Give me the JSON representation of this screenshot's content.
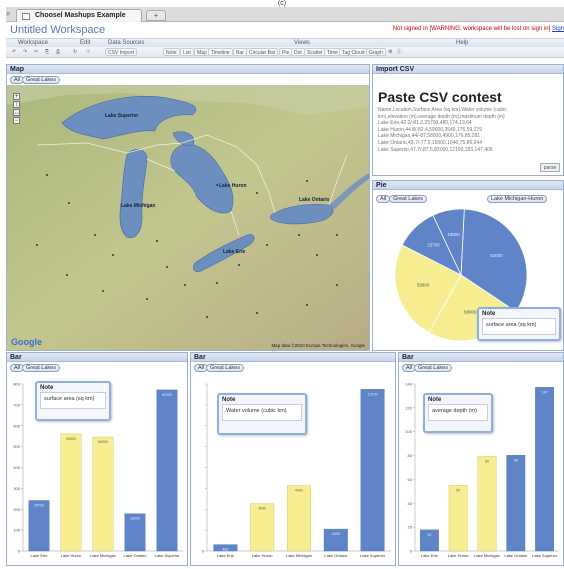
{
  "caption": "(c)",
  "browser": {
    "tab_title": "Choosel Mashups Example",
    "new_tab": "+"
  },
  "app": {
    "workspace_title": "Untitled Workspace",
    "warning": "Not signed in [WARNING: workspace will be lost on sign in]",
    "sign_in": "Sign"
  },
  "menubar": {
    "workspace": "Workspace",
    "edit": "Edit",
    "data_sources": "Data Sources",
    "views": "Views",
    "help": "Help"
  },
  "toolbar": [
    "CSV Import",
    "Note",
    "List",
    "Map",
    "Timeline",
    "Bar",
    "Circular Bar",
    "Pie",
    "Dot",
    "Scatter",
    "Time",
    "Tag Cloud",
    "Graph"
  ],
  "map_panel": {
    "title": "Map",
    "pills": [
      "All",
      "Great Lakes"
    ],
    "labels": [
      "Lake Superior",
      "Lake Michigan",
      "Lake Huron",
      "Lake Ontario",
      "Lake Erie"
    ],
    "google": "Google",
    "copyright": "Map data ©2010 Europa Technologies, Google"
  },
  "csv_panel": {
    "title": "Import CSV",
    "heading": "Paste CSV contest",
    "lines": [
      "Name,Location,Surface Area (sq km),Water volume (cubic",
      "km),elevation (m),average depth (m),maximum depth (m)",
      "Lake Erie,42.2/-81.2,25700,480,174,19,64",
      "Lake Huron,44.8/-82.4,59600,3540,176,59,229",
      "Lake Michigan,44/-87,58000,4900,176,85,281",
      "Lake Ontario,43.7/-77.9,19000,1640,75,86,244",
      "Lake Superior,47.7/-87.5,82000,12100,183,147,406"
    ],
    "parse": "parse"
  },
  "pie_panel": {
    "title": "Pie",
    "pills": [
      "All",
      "Great Lakes"
    ],
    "selected": "Lake Michigan-Huron",
    "note_title": "Note",
    "note_text": "surface area (sq km)"
  },
  "bar_panels": [
    {
      "title": "Bar",
      "pills": [
        "All",
        "Great Lakes"
      ],
      "note_title": "Note",
      "note_text": "surface area (sq km)"
    },
    {
      "title": "Bar",
      "pills": [
        "All",
        "Great Lakes"
      ],
      "note_title": "Note",
      "note_text": "Water volume (cubic km)"
    },
    {
      "title": "Bar",
      "pills": [
        "All",
        "Great Lakes"
      ],
      "note_title": "Note",
      "note_text": "average depth (m)"
    }
  ],
  "colors": {
    "blue": "#5f85c8",
    "yellow": "#f6ee90",
    "selected_blue": "#4877c5"
  },
  "chart_data": [
    {
      "type": "pie",
      "series": [
        {
          "values": [
            82000,
            58000,
            59600,
            25700,
            19000
          ]
        }
      ],
      "highlighted": [
        false,
        true,
        true,
        false,
        false
      ],
      "data_labels": [
        "82000",
        "58000",
        "59600",
        "25700",
        "19000"
      ]
    },
    {
      "type": "bar",
      "categories": [
        "Lake Erie",
        "Lake Huron",
        "Lake Michigan",
        "Lake Ontario",
        "Lake Superior"
      ],
      "values": [
        25700,
        59600,
        58000,
        19000,
        82000
      ],
      "highlighted": [
        false,
        true,
        true,
        false,
        false
      ],
      "ylim": [
        0,
        85000
      ],
      "yticks": [
        "0",
        "100",
        "200",
        "300",
        "400",
        "500",
        "600",
        "700",
        "800"
      ]
    },
    {
      "type": "bar",
      "categories": [
        "Lake Erie",
        "Lake Huron",
        "Lake Michigan",
        "Lake Ontario",
        "Lake Superior"
      ],
      "values": [
        480,
        3540,
        4900,
        1640,
        12100
      ],
      "highlighted": [
        false,
        true,
        true,
        false,
        false
      ],
      "ylim": [
        0,
        12500
      ],
      "yticks": [
        "0",
        "",
        "",
        "",
        "",
        "",
        "",
        "",
        ""
      ]
    },
    {
      "type": "bar",
      "categories": [
        "Lake Erie",
        "Lake Huron",
        "Lake Michigan",
        "Lake Ontario",
        "Lake Superior"
      ],
      "values": [
        19,
        59,
        85,
        86,
        147
      ],
      "highlighted": [
        false,
        true,
        true,
        false,
        false
      ],
      "ylim": [
        0,
        150
      ],
      "yticks": [
        "0",
        "20",
        "40",
        "60",
        "80",
        "100",
        "120",
        "140"
      ]
    }
  ]
}
